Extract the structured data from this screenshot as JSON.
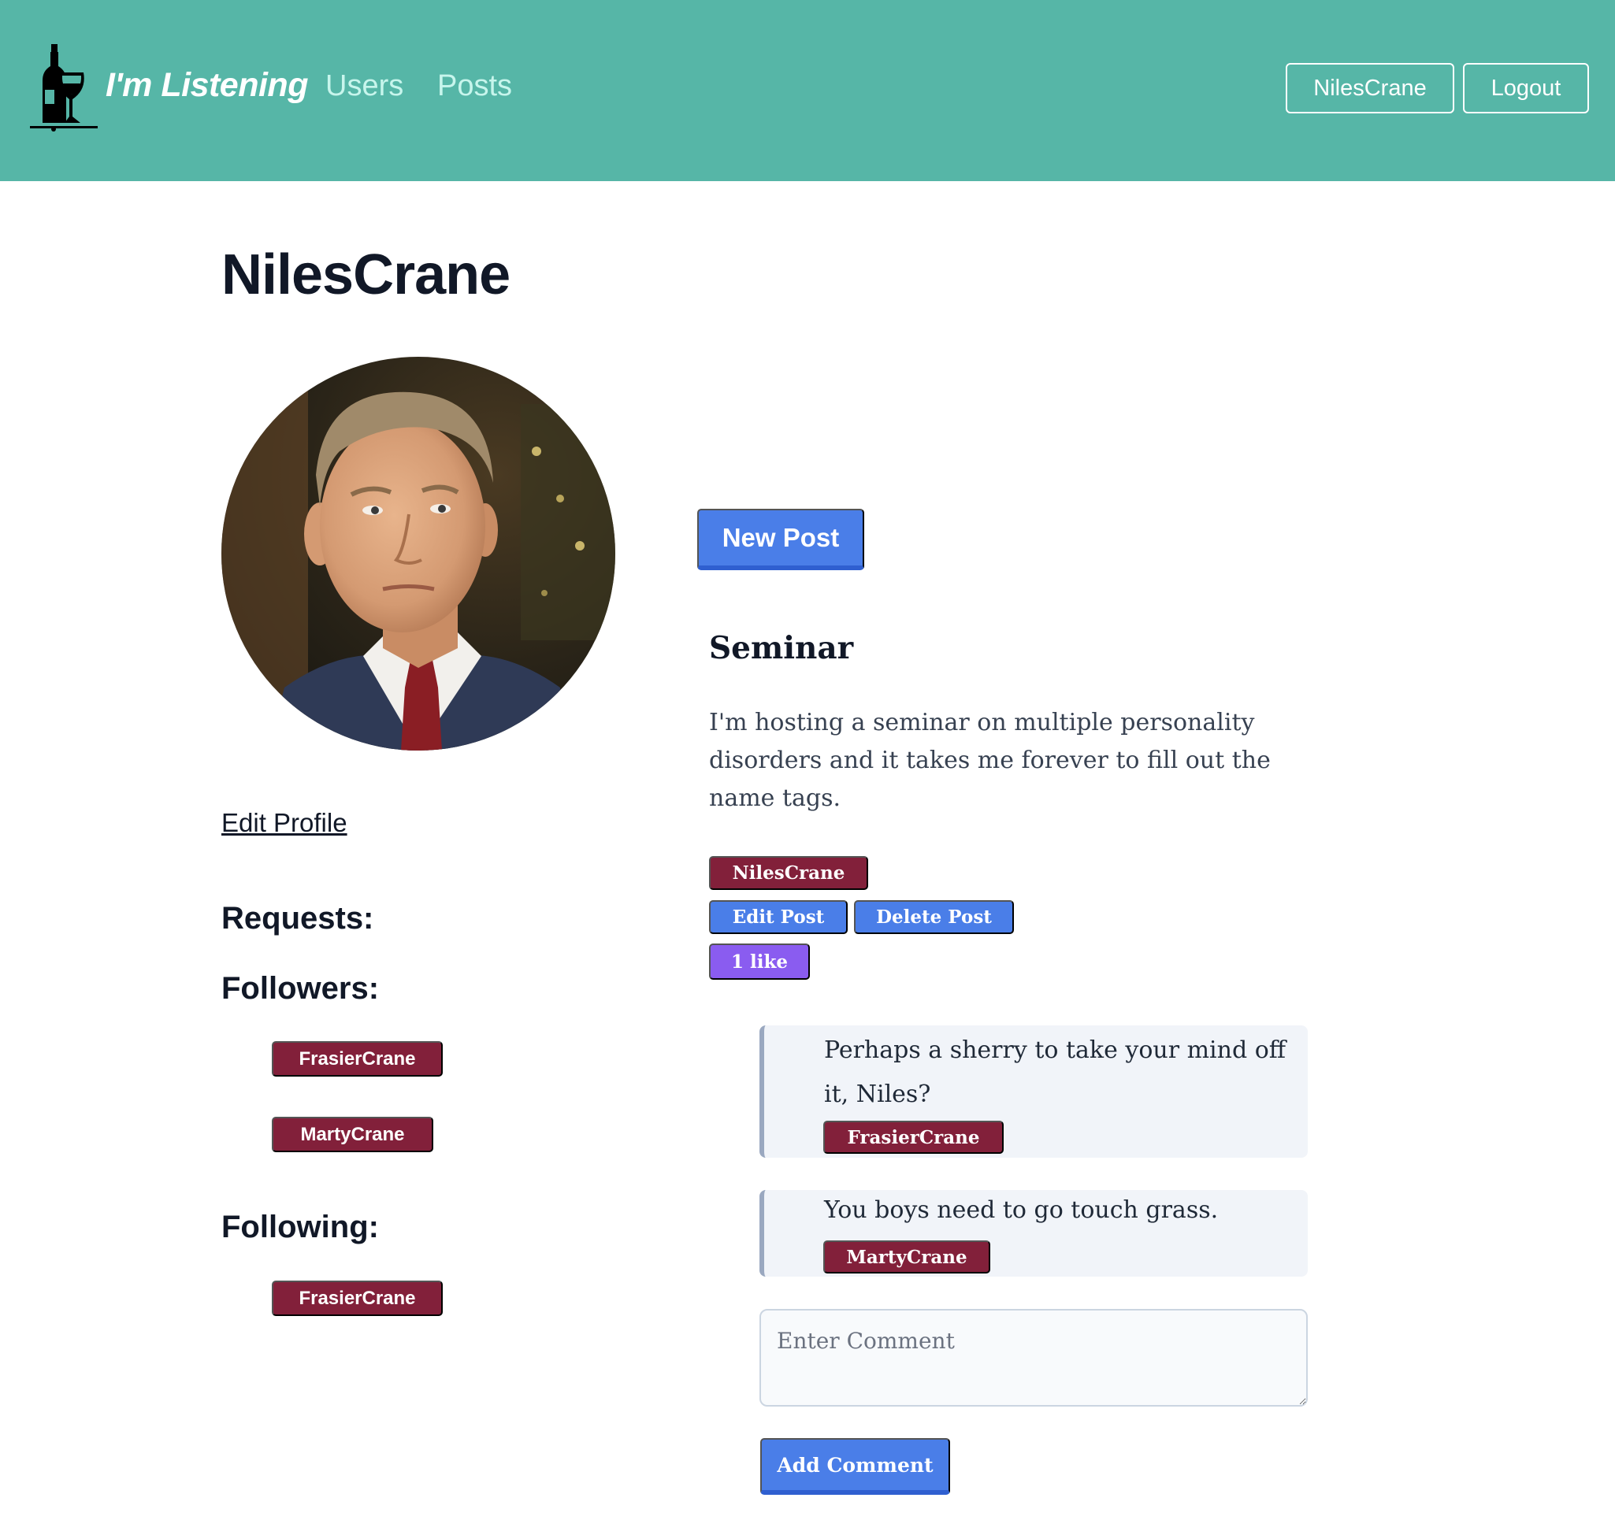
{
  "nav": {
    "brand": "I'm Listening",
    "links": [
      "Users",
      "Posts"
    ],
    "user_button": "NilesCrane",
    "logout_button": "Logout",
    "background_color": "#56b6a7"
  },
  "profile": {
    "username": "NilesCrane",
    "edit_link": "Edit Profile",
    "requests_heading": "Requests:",
    "followers_heading": "Followers:",
    "followers": [
      "FrasierCrane",
      "MartyCrane"
    ],
    "following_heading": "Following:",
    "following": [
      "FrasierCrane"
    ]
  },
  "posts_section": {
    "new_post_button": "New Post",
    "post": {
      "title": "Seminar",
      "body": "I'm hosting a seminar on multiple personality disorders and it takes me forever to fill out the name tags.",
      "author": "NilesCrane",
      "edit_button": "Edit Post",
      "delete_button": "Delete Post",
      "likes_label": "1 like",
      "comments": [
        {
          "text": "Perhaps a sherry to take your mind off it, Niles?",
          "author": "FrasierCrane"
        },
        {
          "text": "You boys need to go touch grass.",
          "author": "MartyCrane"
        }
      ],
      "comment_placeholder": "Enter Comment",
      "add_comment_button": "Add Comment"
    }
  },
  "colors": {
    "accent_teal": "#56b6a7",
    "badge_maroon": "#82203a",
    "button_blue": "#4a7ee8",
    "like_purple": "#8a5cf0"
  }
}
